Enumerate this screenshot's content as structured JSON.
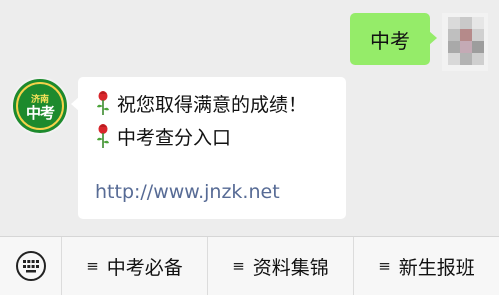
{
  "outgoing_message": {
    "text": "中考"
  },
  "incoming_message": {
    "avatar_top_text": "济南",
    "avatar_main_text": "中考",
    "lines": [
      "祝您取得满意的成绩！",
      "中考查分入口"
    ],
    "link_text": "http://www.jnzk.net"
  },
  "menu": {
    "items": [
      {
        "label": "中考必备",
        "icon": "menu-lines-icon"
      },
      {
        "label": "资料集锦",
        "icon": "menu-lines-icon"
      },
      {
        "label": "新生报班",
        "icon": "menu-lines-icon"
      }
    ],
    "hamburger_glyph": "≡"
  },
  "colors": {
    "background": "#ededed",
    "outgoing_bubble": "#95ec69",
    "incoming_bubble": "#ffffff",
    "link": "#576b95",
    "avatar_green": "#1d8a2d",
    "avatar_gold": "#f5d24a"
  }
}
